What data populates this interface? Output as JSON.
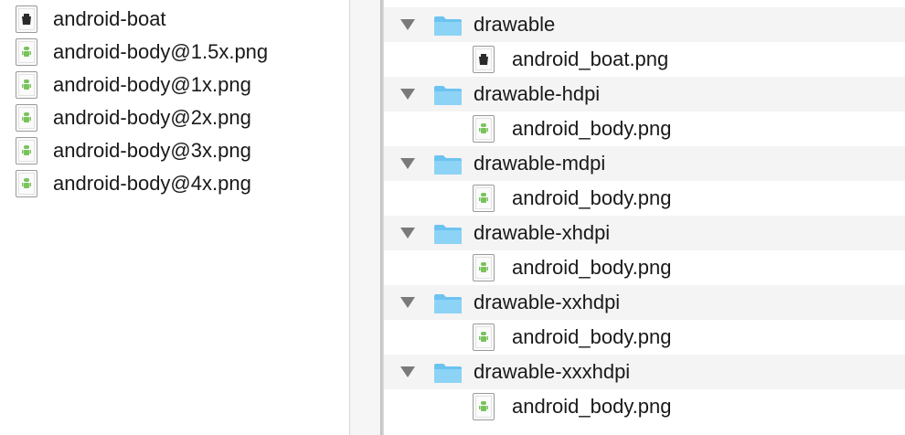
{
  "left_list": {
    "items": [
      {
        "label": "android-boat",
        "icon": "boat-image-icon"
      },
      {
        "label": "android-body@1.5x.png",
        "icon": "android-image-icon"
      },
      {
        "label": "android-body@1x.png",
        "icon": "android-image-icon"
      },
      {
        "label": "android-body@2x.png",
        "icon": "android-image-icon"
      },
      {
        "label": "android-body@3x.png",
        "icon": "android-image-icon"
      },
      {
        "label": "android-body@4x.png",
        "icon": "android-image-icon"
      }
    ]
  },
  "tree": {
    "folders": [
      {
        "name": "drawable",
        "file": "android_boat.png",
        "file_icon": "boat-image-icon"
      },
      {
        "name": "drawable-hdpi",
        "file": "android_body.png",
        "file_icon": "android-image-icon"
      },
      {
        "name": "drawable-mdpi",
        "file": "android_body.png",
        "file_icon": "android-image-icon"
      },
      {
        "name": "drawable-xhdpi",
        "file": "android_body.png",
        "file_icon": "android-image-icon"
      },
      {
        "name": "drawable-xxhdpi",
        "file": "android_body.png",
        "file_icon": "android-image-icon"
      },
      {
        "name": "drawable-xxxhdpi",
        "file": "android_body.png",
        "file_icon": "android-image-icon"
      }
    ]
  },
  "colors": {
    "folder_blue": "#6cc3f0",
    "android_green": "#79c35c",
    "boat_dark": "#2b2b2b"
  }
}
